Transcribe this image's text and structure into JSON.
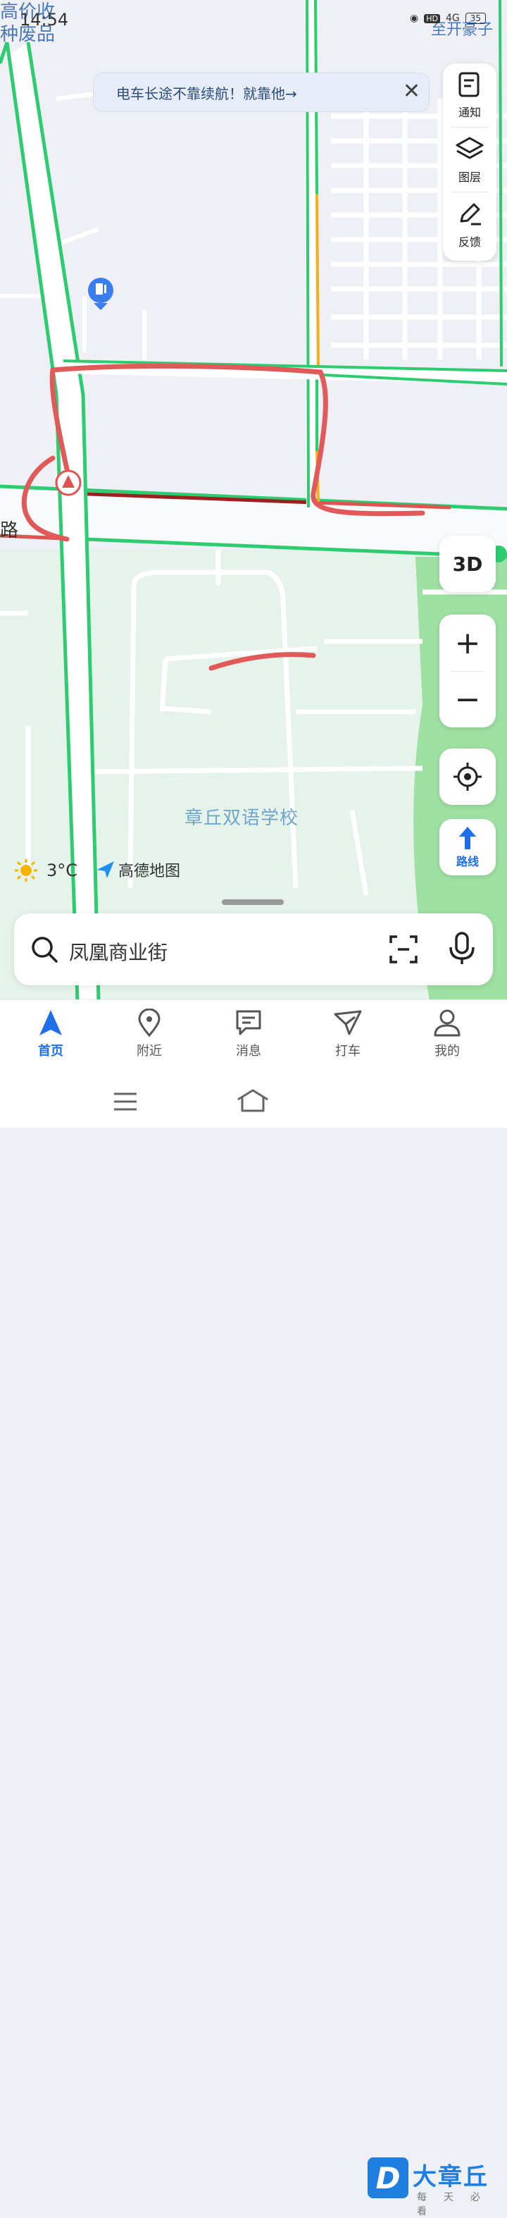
{
  "status_bar": {
    "time": "14:54",
    "hd": "HD",
    "signal": "4G",
    "battery": "35"
  },
  "map": {
    "corner_labels": [
      "高价收",
      "种废品",
      "至开豪子"
    ],
    "road_label": "路",
    "school_label": "章丘双语学校",
    "colors": {
      "smooth": "#2ecc71",
      "slow": "#f2b01e",
      "congested": "#e05353",
      "blocked": "#9b2020",
      "annotation": "#e05a5a",
      "park": "#8fdc93"
    }
  },
  "banner": {
    "text": "电车长途不靠续航！就靠他→",
    "close_icon": "close-icon"
  },
  "right_panel": {
    "items": [
      {
        "label": "通知",
        "icon": "notice-icon"
      },
      {
        "label": "图层",
        "icon": "layers-icon"
      },
      {
        "label": "反馈",
        "icon": "edit-icon"
      }
    ]
  },
  "controls": {
    "view_3d": "3D",
    "zoom_in": "+",
    "zoom_out": "−",
    "route_label": "路线"
  },
  "weather": {
    "temperature": "3°C"
  },
  "brand": {
    "name": "高德地图"
  },
  "search": {
    "placeholder": "凤凰商业街"
  },
  "tabs": [
    {
      "label": "首页",
      "active": true
    },
    {
      "label": "附近",
      "active": false
    },
    {
      "label": "消息",
      "active": false
    },
    {
      "label": "打车",
      "active": false
    },
    {
      "label": "我的",
      "active": false
    }
  ],
  "watermark": {
    "logo": "D",
    "title": "大章丘",
    "subtitle": "每天必看"
  }
}
